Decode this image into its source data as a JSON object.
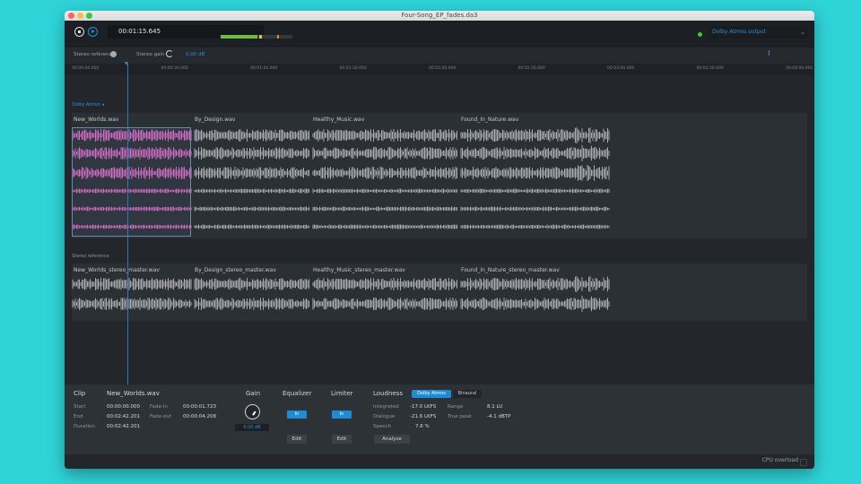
{
  "window": {
    "title": "Four-Song_EP_fades.da3"
  },
  "transport": {
    "timecode": "00:01:15.645",
    "output_device": "Dolby Atmos output",
    "meter_level": 0.55
  },
  "options": {
    "stereo_reference_label": "Stereo reference",
    "stereo_gain_label": "Stereo gain",
    "stereo_gain_value": "0.00 dB"
  },
  "ruler": {
    "ticks": [
      "00:00:00.000",
      "00:00:30.000",
      "00:01:00.000",
      "00:01:30.000",
      "00:02:00.000",
      "00:02:30.000",
      "00:03:00.000",
      "00:03:30.000",
      "00:04:00.000"
    ]
  },
  "tracks": {
    "atmos_lane_label": "Dolby Atmos",
    "stereo_lane_label": "Stereo reference",
    "atmos_clips": [
      "New_Worlds.wav",
      "By_Design.wav",
      "Healthy_Music.wav",
      "Found_In_Nature.wav"
    ],
    "stereo_clips": [
      "New_Worlds_stereo_master.wav",
      "By_Design_stereo_master.wav",
      "Healthy_Music_stereo_master.wav",
      "Found_In_Nature_stereo_master.wav"
    ]
  },
  "clip": {
    "section": "Clip",
    "name": "New_Worlds.wav",
    "start_label": "Start",
    "start": "00:00:00.000",
    "end_label": "End",
    "end": "00:02:42.201",
    "duration_label": "Duration",
    "duration": "00:02:42.201",
    "fade_in_label": "Fade-in",
    "fade_in": "00:00:01.723",
    "fade_out_label": "Fade-out",
    "fade_out": "00:00:04.208"
  },
  "gain": {
    "title": "Gain",
    "value": "0.00 dB"
  },
  "equalizer": {
    "title": "Equalizer",
    "in_label": "In",
    "edit_label": "Edit"
  },
  "limiter": {
    "title": "Limiter",
    "in_label": "In",
    "edit_label": "Edit"
  },
  "loudness": {
    "title": "Loudness",
    "mode_atmos": "Dolby Atmos",
    "mode_binaural": "Binaural",
    "integrated_label": "Integrated",
    "integrated": "-17.0 LKFS",
    "dialogue_label": "Dialogue",
    "dialogue": "-21.6 LKFS",
    "speech_label": "Speech",
    "speech": "7.6 %",
    "range_label": "Range",
    "range": "8.1 LU",
    "true_peak_label": "True peak",
    "true_peak": "-4.1 dBTP",
    "analyze_label": "Analyze"
  },
  "footer": {
    "cpu_label": "CPU overload"
  },
  "colors": {
    "accent": "#1f8bd6",
    "waveform_selected": "#e86fd0",
    "waveform": "#a9adb1",
    "background": "#2fd4d8"
  }
}
